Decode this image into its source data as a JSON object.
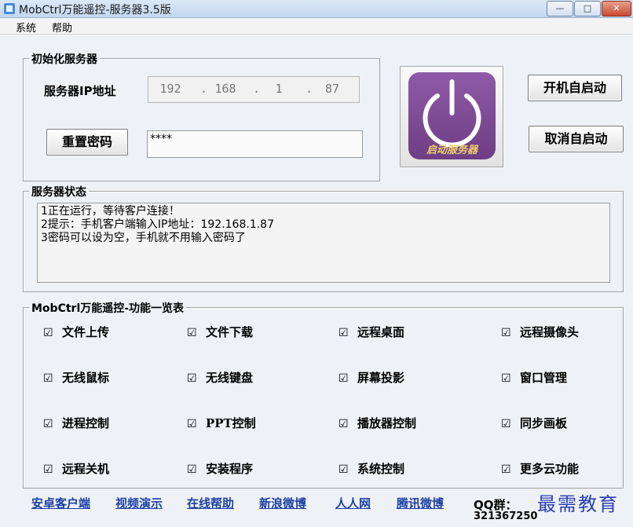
{
  "window": {
    "title": "MobCtrl万能遥控-服务器3.5版",
    "buttons": {
      "minimize": "—",
      "maximize": "□",
      "close": "✕"
    }
  },
  "menu": {
    "items": [
      "系统",
      "帮助"
    ]
  },
  "init_group": {
    "title": "初始化服务器",
    "ip_label": "服务器IP地址",
    "ip_parts": [
      "192",
      "168",
      "1",
      "87"
    ],
    "reset_button": "重置密码",
    "password_value": "****"
  },
  "power_button": {
    "label": "启动服务器",
    "icon": "power-icon"
  },
  "autostart": {
    "enable": "开机自启动",
    "disable": "取消自启动"
  },
  "status_group": {
    "title": "服务器状态",
    "lines": [
      "1正在运行，等待客户连接！",
      "2提示：手机客户端输入IP地址：192.168.1.87",
      "3密码可以设为空，手机就不用输入密码了"
    ]
  },
  "features_group": {
    "title": "MobCtrl万能遥控-功能一览表",
    "check_mark": "☑",
    "items": [
      "文件上传",
      "文件下载",
      "远程桌面",
      "远程摄像头",
      "无线鼠标",
      "无线键盘",
      "屏幕投影",
      "窗口管理",
      "进程控制",
      "PPT控制",
      "播放器控制",
      "同步画板",
      "远程关机",
      "安装程序",
      "系统控制",
      "更多云功能"
    ]
  },
  "footer": {
    "links": [
      "安卓客户端",
      "视频演示",
      "在线帮助",
      "新浪微博",
      "人人网",
      "腾讯微博"
    ],
    "qq_label": "QQ群：",
    "qq_number": "321367250"
  },
  "watermark": "最需教育",
  "colors": {
    "link": "#1c3fa4",
    "power_tile": "#7d4a94",
    "power_label": "#f0cf6e"
  }
}
